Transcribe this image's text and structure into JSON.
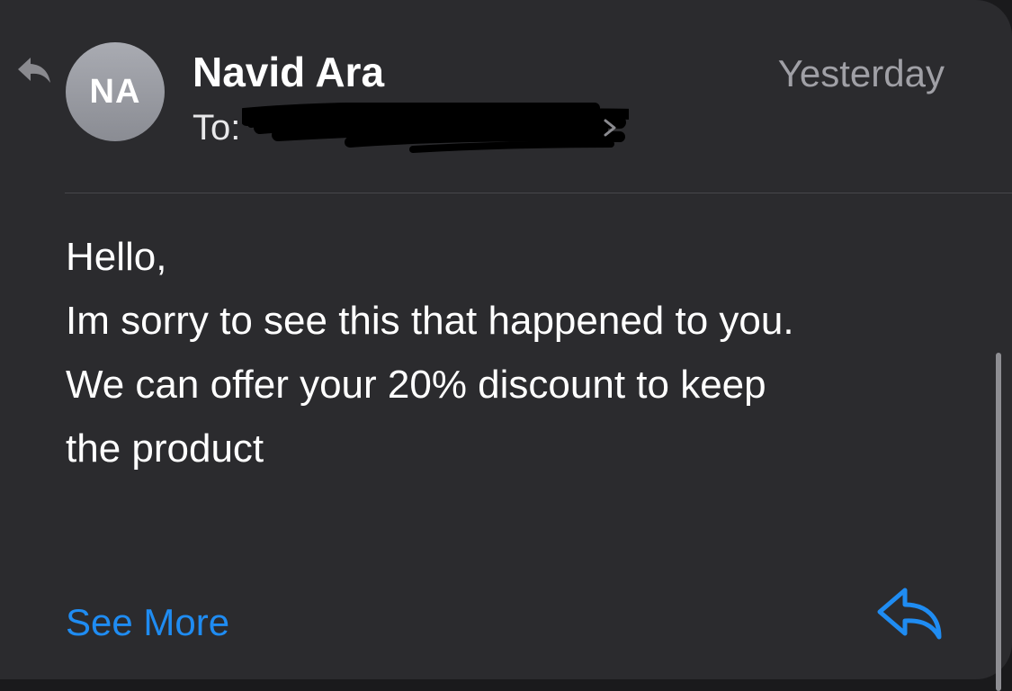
{
  "message": {
    "avatar_initials": "NA",
    "sender_name": "Navid Ara",
    "to_label": "To:",
    "date": "Yesterday",
    "body_lines": [
      "Hello,",
      "Im sorry to see this that happened to you.",
      "We can offer your 20% discount to keep",
      "the product"
    ],
    "see_more_label": "See More"
  },
  "icons": {
    "replied_indicator": "arrow-uturn-left-icon",
    "reply": "reply-arrow-icon"
  },
  "colors": {
    "background": "#2b2b2e",
    "text": "#ffffff",
    "secondary_text": "#a0a0a6",
    "accent": "#1f8cf2",
    "avatar": "#9c9ea5"
  }
}
